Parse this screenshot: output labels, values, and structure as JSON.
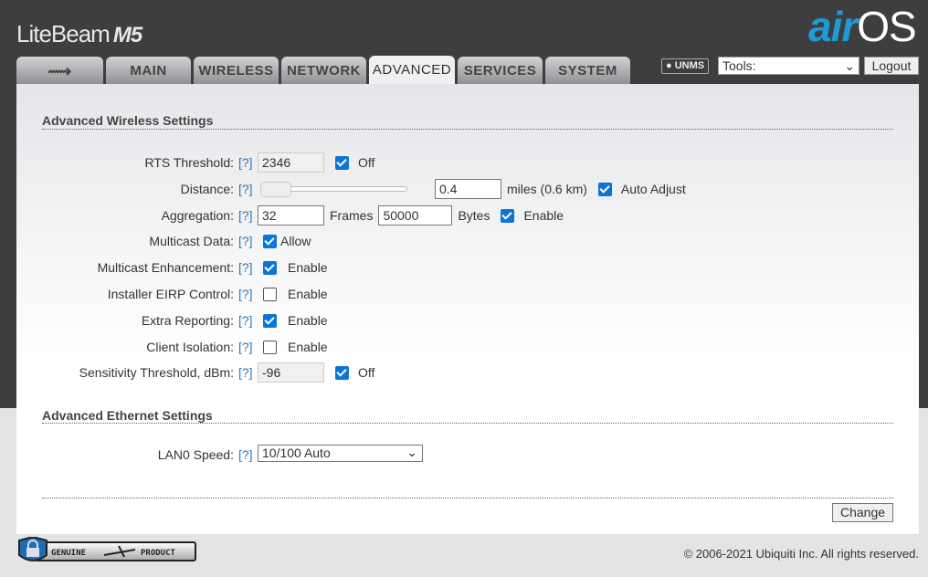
{
  "header": {
    "brand": "LiteBeam",
    "model": "M5",
    "logo_a": "air",
    "logo_b": "OS",
    "unms": "UNMS",
    "tools": "Tools:",
    "logout": "Logout"
  },
  "tabs": [
    {
      "label": "",
      "icon": "ubiquiti-logo-icon"
    },
    {
      "label": "MAIN"
    },
    {
      "label": "WIRELESS"
    },
    {
      "label": "NETWORK"
    },
    {
      "label": "ADVANCED",
      "active": true
    },
    {
      "label": "SERVICES"
    },
    {
      "label": "SYSTEM"
    }
  ],
  "wireless": {
    "title": "Advanced Wireless Settings",
    "help": "[?]",
    "rts": {
      "label": "RTS Threshold:",
      "value": "2346",
      "check": "Off",
      "checked": true
    },
    "distance": {
      "label": "Distance:",
      "value": "0.4",
      "unit": "miles (0.6 km)",
      "check": "Auto Adjust",
      "checked": true,
      "slider": 0
    },
    "aggregation": {
      "label": "Aggregation:",
      "frames": "32",
      "frames_label": "Frames",
      "bytes": "50000",
      "bytes_label": "Bytes",
      "check": "Enable",
      "checked": true
    },
    "multicast": {
      "label": "Multicast Data:",
      "check": "Allow",
      "checked": true
    },
    "mcast_enh": {
      "label": "Multicast Enhancement:",
      "check": "Enable",
      "checked": true
    },
    "eirp": {
      "label": "Installer EIRP Control:",
      "check": "Enable",
      "checked": false
    },
    "reporting": {
      "label": "Extra Reporting:",
      "check": "Enable",
      "checked": true
    },
    "isolation": {
      "label": "Client Isolation:",
      "check": "Enable",
      "checked": false
    },
    "sensitivity": {
      "label": "Sensitivity Threshold, dBm:",
      "value": "-96",
      "check": "Off",
      "checked": true
    }
  },
  "ethernet": {
    "title": "Advanced Ethernet Settings",
    "lan0": {
      "label": "LAN0 Speed:",
      "value": "10/100 Auto"
    }
  },
  "change": "Change",
  "footer": {
    "badge_left": "GENUINE",
    "badge_right": "PRODUCT",
    "copyright": "© 2006-2021 Ubiquiti Inc. All rights reserved."
  }
}
